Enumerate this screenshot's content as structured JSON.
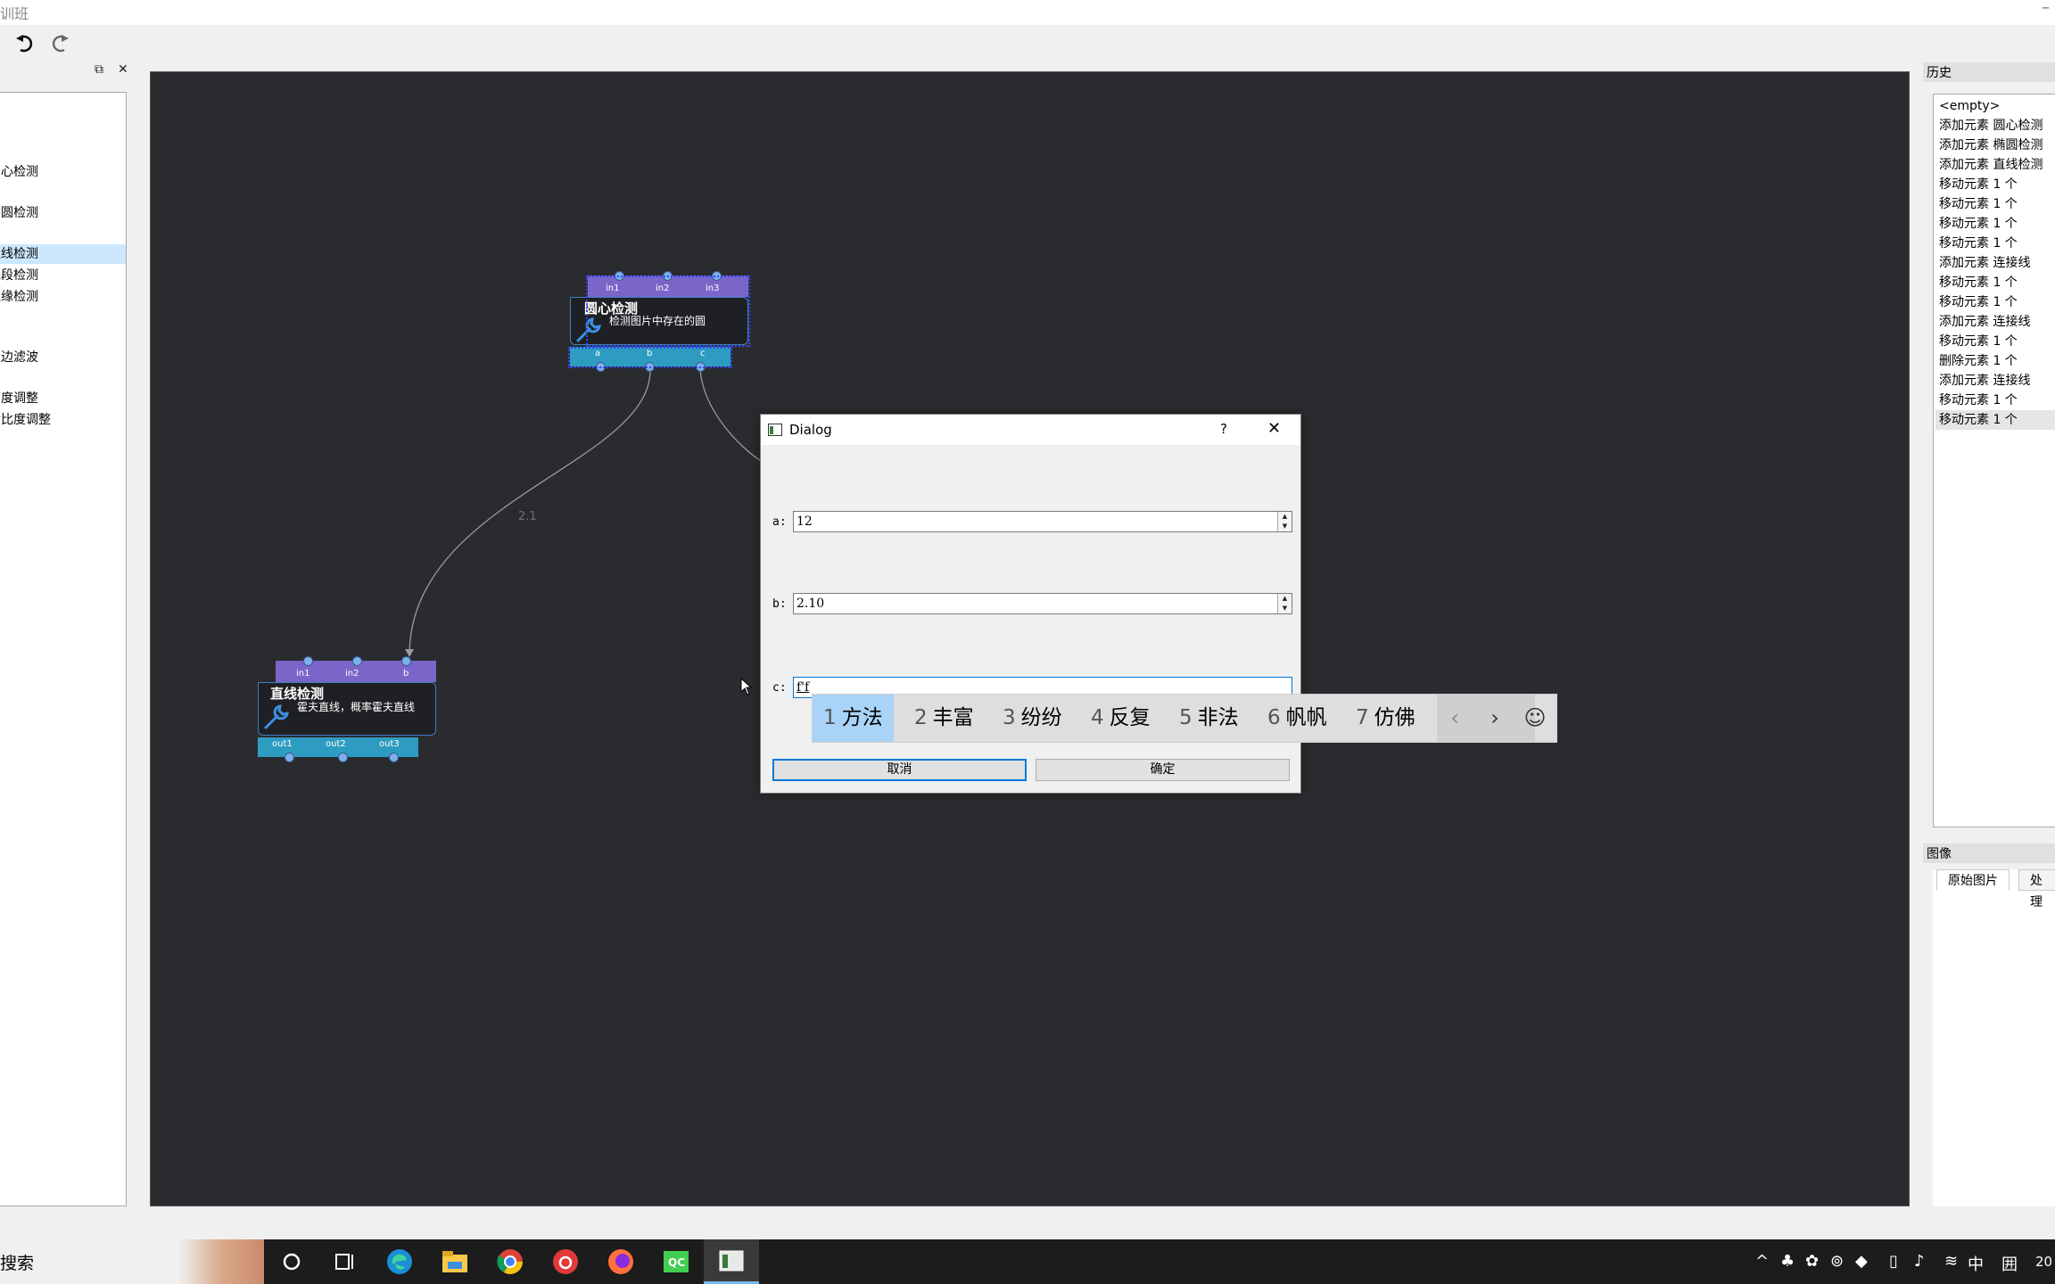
{
  "window": {
    "title": "训班"
  },
  "toolbar": {
    "undo_icon": "undo-icon",
    "redo_icon": "redo-icon"
  },
  "left_panel": {
    "float_icon": "float-icon",
    "close_icon": "close-icon",
    "items": [
      {
        "label": "圆心检测"
      },
      {
        "label": "椭圆检测"
      },
      {
        "label": "直线检测",
        "selected": true
      },
      {
        "label": "线段检测"
      },
      {
        "label": "边缘检测"
      },
      {
        "label": "双边滤波"
      },
      {
        "label": "亮度调整"
      },
      {
        "label": "对比度调整"
      }
    ]
  },
  "canvas": {
    "edge_label": "2.1",
    "node_circle": {
      "title": "圆心检测",
      "desc": "检测图片中存在的圆",
      "inputs": [
        "in1",
        "in2",
        "in3"
      ],
      "outputs": [
        "a",
        "b",
        "c"
      ]
    },
    "node_line": {
      "title": "直线检测",
      "desc": "霍夫直线，概率霍夫直线",
      "inputs": [
        "in1",
        "in2",
        "b"
      ],
      "outputs": [
        "out1",
        "out2",
        "out3"
      ]
    }
  },
  "history": {
    "title": "历史",
    "items": [
      "<empty>",
      "添加元素 圆心检测",
      "添加元素 椭圆检测",
      "添加元素 直线检测",
      "移动元素 1 个",
      "移动元素 1 个",
      "移动元素 1 个",
      "移动元素 1 个",
      "添加元素 连接线",
      "移动元素 1 个",
      "移动元素 1 个",
      "添加元素 连接线",
      "移动元素 1 个",
      "删除元素 1 个",
      "添加元素 连接线",
      "移动元素 1 个",
      "移动元素 1 个"
    ]
  },
  "image_panel": {
    "title": "图像",
    "tabs": [
      "原始图片",
      "处理"
    ]
  },
  "dialog": {
    "title": "Dialog",
    "help": "?",
    "fields": [
      {
        "label": "a:",
        "value": "12"
      },
      {
        "label": "b:",
        "value": "2.10"
      },
      {
        "label": "c:",
        "value": "f'f"
      }
    ],
    "cancel": "取消",
    "ok": "确定"
  },
  "ime": {
    "candidates": [
      {
        "num": "1",
        "text": "方法"
      },
      {
        "num": "2",
        "text": "丰富"
      },
      {
        "num": "3",
        "text": "纷纷"
      },
      {
        "num": "4",
        "text": "反复"
      },
      {
        "num": "5",
        "text": "非法"
      },
      {
        "num": "6",
        "text": "帆帆"
      },
      {
        "num": "7",
        "text": "仿佛"
      }
    ],
    "prev": "‹",
    "next": "›",
    "emoji": "☺"
  },
  "taskbar": {
    "search": "搜索",
    "tray_lang": "中",
    "tray_layout": "囲",
    "clock": "20"
  },
  "colors": {
    "canvas_bg": "#2a2b2e",
    "node_inputs": "#7b65c9",
    "node_outputs": "#2e9cc1",
    "ime_highlight": "#a9d3f7",
    "selection": "#cce8ff"
  }
}
